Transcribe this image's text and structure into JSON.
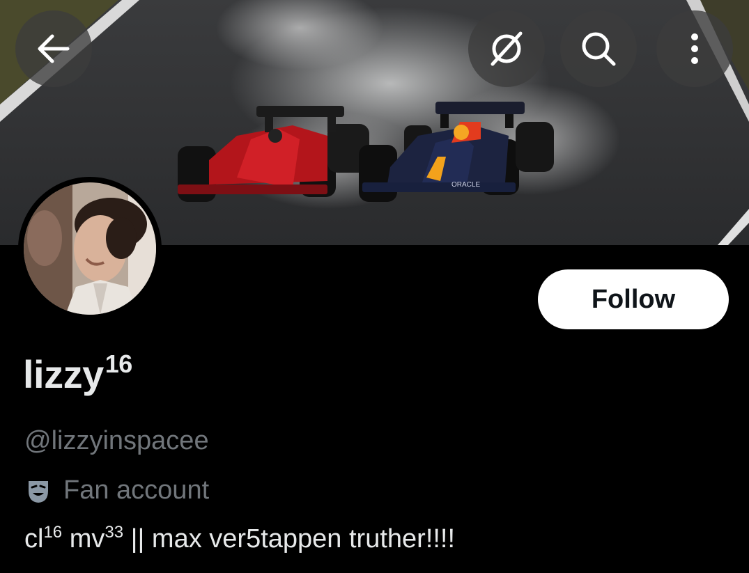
{
  "header": {
    "back_icon": "arrow-left-icon",
    "grok_icon": "grok-icon",
    "search_icon": "search-icon",
    "more_icon": "more-vertical-icon"
  },
  "profile": {
    "display_name": "lizzy",
    "display_name_sup": "16",
    "handle": "@lizzyinspacee",
    "category_icon": "theater-mask-icon",
    "category": "Fan account",
    "bio": {
      "part1": "cl",
      "sup1": "16",
      "part2": " mv",
      "sup2": "33",
      "part3": " || max ver5tappen truther!!!!"
    }
  },
  "actions": {
    "follow_label": "Follow"
  },
  "colors": {
    "background": "#000000",
    "primary_text": "#e7e9ea",
    "secondary_text": "#71767b",
    "follow_bg": "#ffffff",
    "follow_text": "#0f1419"
  }
}
